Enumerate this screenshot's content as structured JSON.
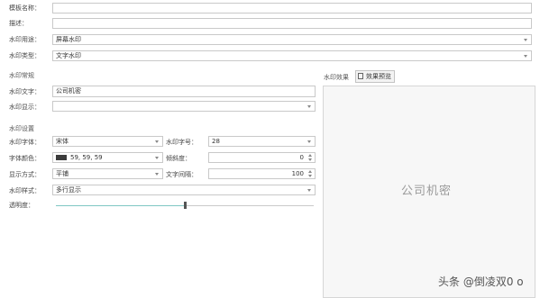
{
  "form": {
    "template_name_label": "模板名称：",
    "template_name_value": "",
    "description_label": "描述：",
    "description_value": "",
    "usage_label": "水印用途：",
    "usage_value": "屏幕水印",
    "type_label": "水印类型：",
    "type_value": "文字水印"
  },
  "content": {
    "section_title": "水印常规",
    "text_label": "水印文字：",
    "text_value": "公司机密",
    "display_label": "水印显示：",
    "display_value": ""
  },
  "settings": {
    "section_title": "水印设置",
    "font_label": "水印字体：",
    "font_value": "宋体",
    "size_label": "水印字号：",
    "size_value": "28",
    "color_label": "字体颜色：",
    "color_value": "59, 59, 59",
    "color_hex": "#3b3b3b",
    "tilt_label": "倾斜度：",
    "tilt_value": "0",
    "display_mode_label": "显示方式：",
    "display_mode_value": "平铺",
    "spacing_label": "文字间隔：",
    "spacing_value": "100",
    "style_label": "水印样式：",
    "style_value": "多行显示",
    "opacity_label": "透明度：",
    "opacity_level": 0.5
  },
  "preview": {
    "title": "水印效果",
    "button_label": "效果预览",
    "preview_text": "公司机密"
  },
  "overlay": {
    "watermark_text": "头条 @倒凌双0 o"
  }
}
